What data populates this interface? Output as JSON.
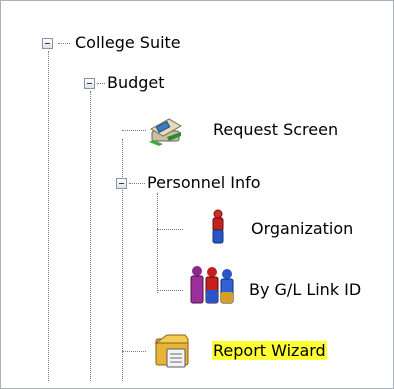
{
  "tree": {
    "root": {
      "label": "College Suite",
      "expanded": true
    },
    "budget": {
      "label": "Budget",
      "expanded": true
    },
    "request_screen": {
      "label": "Request Screen",
      "icon": "request-screen-icon"
    },
    "personnel_info": {
      "label": "Personnel Info",
      "expanded": true
    },
    "organization": {
      "label": "Organization",
      "icon": "organization-icon"
    },
    "gl_link": {
      "label": "By G/L Link ID",
      "icon": "gl-link-icon"
    },
    "report_wizard": {
      "label": "Report Wizard",
      "icon": "report-wizard-icon",
      "highlighted": true
    }
  },
  "colors": {
    "highlight": "#ffff33",
    "tree_line": "#7a7a7a"
  }
}
